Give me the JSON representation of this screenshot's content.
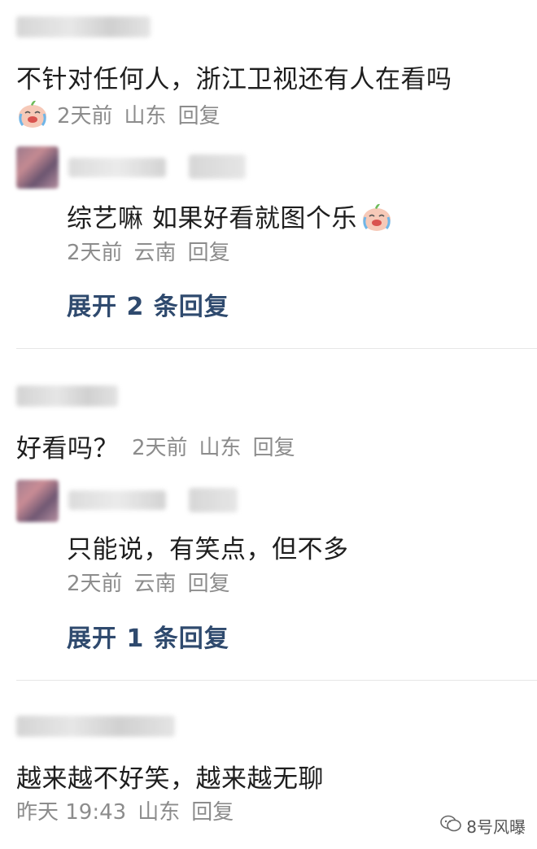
{
  "comments": [
    {
      "text": "不针对任何人，浙江卫视还有人在看吗",
      "time": "2天前",
      "location": "山东",
      "reply_label": "回复",
      "replies": [
        {
          "text": "综艺嘛 如果好看就图个乐",
          "time": "2天前",
          "location": "云南",
          "reply_label": "回复"
        }
      ],
      "expand_label": "展开 2 条回复"
    },
    {
      "text": "好看吗？",
      "time": "2天前",
      "location": "山东",
      "reply_label": "回复",
      "replies": [
        {
          "text": "只能说，有笑点，但不多",
          "time": "2天前",
          "location": "云南",
          "reply_label": "回复"
        }
      ],
      "expand_label": "展开 1 条回复"
    },
    {
      "text": "越来越不好笑，越来越无聊",
      "time": "昨天 19:43",
      "location": "山东",
      "reply_label": "回复"
    }
  ],
  "watermark": "8号风曝",
  "colors": {
    "expand": "#2f4a6e",
    "meta": "#8c8c8c",
    "divider": "#e6e6e6"
  }
}
